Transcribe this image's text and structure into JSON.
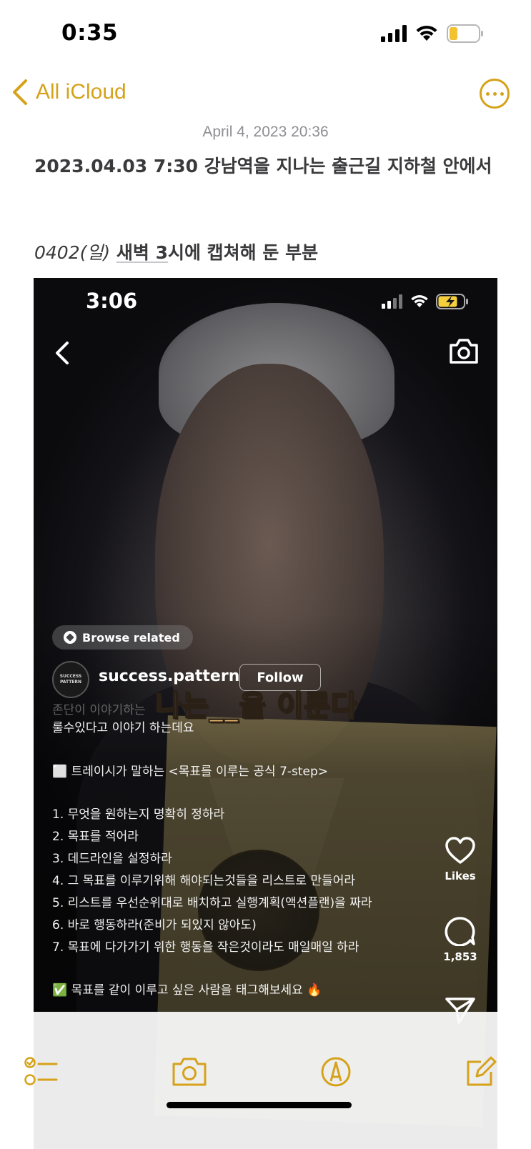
{
  "status_bar": {
    "time": "0:35"
  },
  "nav": {
    "back_label": "All iCloud"
  },
  "note": {
    "date": "April 4, 2023 20:36",
    "title": "2023.04.03 7:30 강남역을 지나는 출근길 지하철 안에서",
    "subtitle_italic": "0402(일)",
    "subtitle_underlined": "새벽 3",
    "subtitle_rest": "시에 캡쳐해 둔 부분"
  },
  "embedded": {
    "time": "3:06",
    "browse_label": "Browse related",
    "avatar_text": "SUCCESS PATTERN",
    "username": "success.pattern",
    "follow_label": "Follow",
    "caption_overlay": "나는__을 이룬다",
    "faded_text": "존단이 이야기하는",
    "post_lines": [
      "룰수있다고 이야기 하는데요",
      "⬜ 트레이시가 말하는 <목표를 이루는 공식 7-step>",
      "1. 무엇을 원하는지 명확히 정하라",
      "2. 목표를 적어라",
      "3. 데드라인을 설정하라",
      "4. 그 목표를 이루기위해 해야되는것들을 리스트로 만들어라",
      "5. 리스트를 우선순위대로 배치하고 실행계획(액션플랜)을 짜라",
      "6. 바로 행동하라(준비가 되있지 않아도)",
      "7. 목표에 다가가기 위한 행동을 작은것이라도 매일매일 하라",
      "✅ 목표를 같이 이루고 싶은 사람을 태그해보세요 🔥"
    ],
    "likes_label": "Likes",
    "comments_count": "1,853"
  },
  "colors": {
    "accent": "#d6a21a",
    "note_text": "#3a3a3c",
    "date_text": "#8e8e93"
  }
}
